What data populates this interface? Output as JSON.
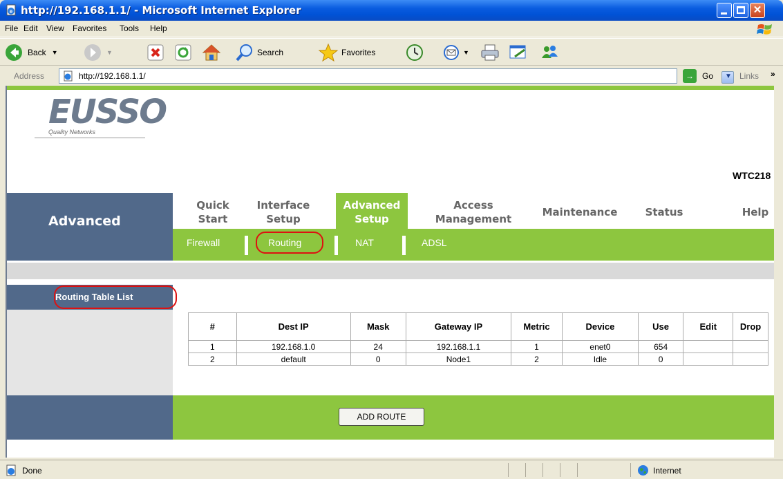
{
  "window": {
    "title": "http://192.168.1.1/ - Microsoft Internet Explorer"
  },
  "menubar": {
    "items": [
      "File",
      "Edit",
      "View",
      "Favorites",
      "Tools",
      "Help"
    ]
  },
  "toolbar": {
    "back": "Back",
    "search": "Search",
    "favorites": "Favorites"
  },
  "address": {
    "label": "Address",
    "url": "http://192.168.1.1/",
    "go": "Go",
    "links": "Links"
  },
  "page": {
    "logo": {
      "brand": "EUSSO",
      "tagline": "Quality Networks"
    },
    "model": "WTC218",
    "section": "Advanced",
    "nav_tabs": [
      {
        "line1": "Quick",
        "line2": "Start"
      },
      {
        "line1": "Interface",
        "line2": "Setup"
      },
      {
        "line1": "Advanced",
        "line2": "Setup"
      },
      {
        "line1": "Access",
        "line2": "Management"
      },
      {
        "line1": "Maintenance",
        "line2": ""
      },
      {
        "line1": "Status",
        "line2": ""
      },
      {
        "line1": "Help",
        "line2": ""
      }
    ],
    "sub_tabs": [
      "Firewall",
      "Routing",
      "NAT",
      "ADSL"
    ],
    "table_title": "Routing Table List",
    "table": {
      "headers": [
        "#",
        "Dest IP",
        "Mask",
        "Gateway IP",
        "Metric",
        "Device",
        "Use",
        "Edit",
        "Drop"
      ],
      "rows": [
        [
          "1",
          "192.168.1.0",
          "24",
          "192.168.1.1",
          "1",
          "enet0",
          "654",
          "",
          ""
        ],
        [
          "2",
          "default",
          "0",
          "Node1",
          "2",
          "Idle",
          "0",
          "",
          ""
        ]
      ]
    },
    "add_button": "ADD ROUTE"
  },
  "status": {
    "text": "Done",
    "zone": "Internet"
  },
  "colors": {
    "accent_green": "#8dc63f",
    "nav_blue": "#51698a",
    "highlight_red": "#d11111"
  }
}
